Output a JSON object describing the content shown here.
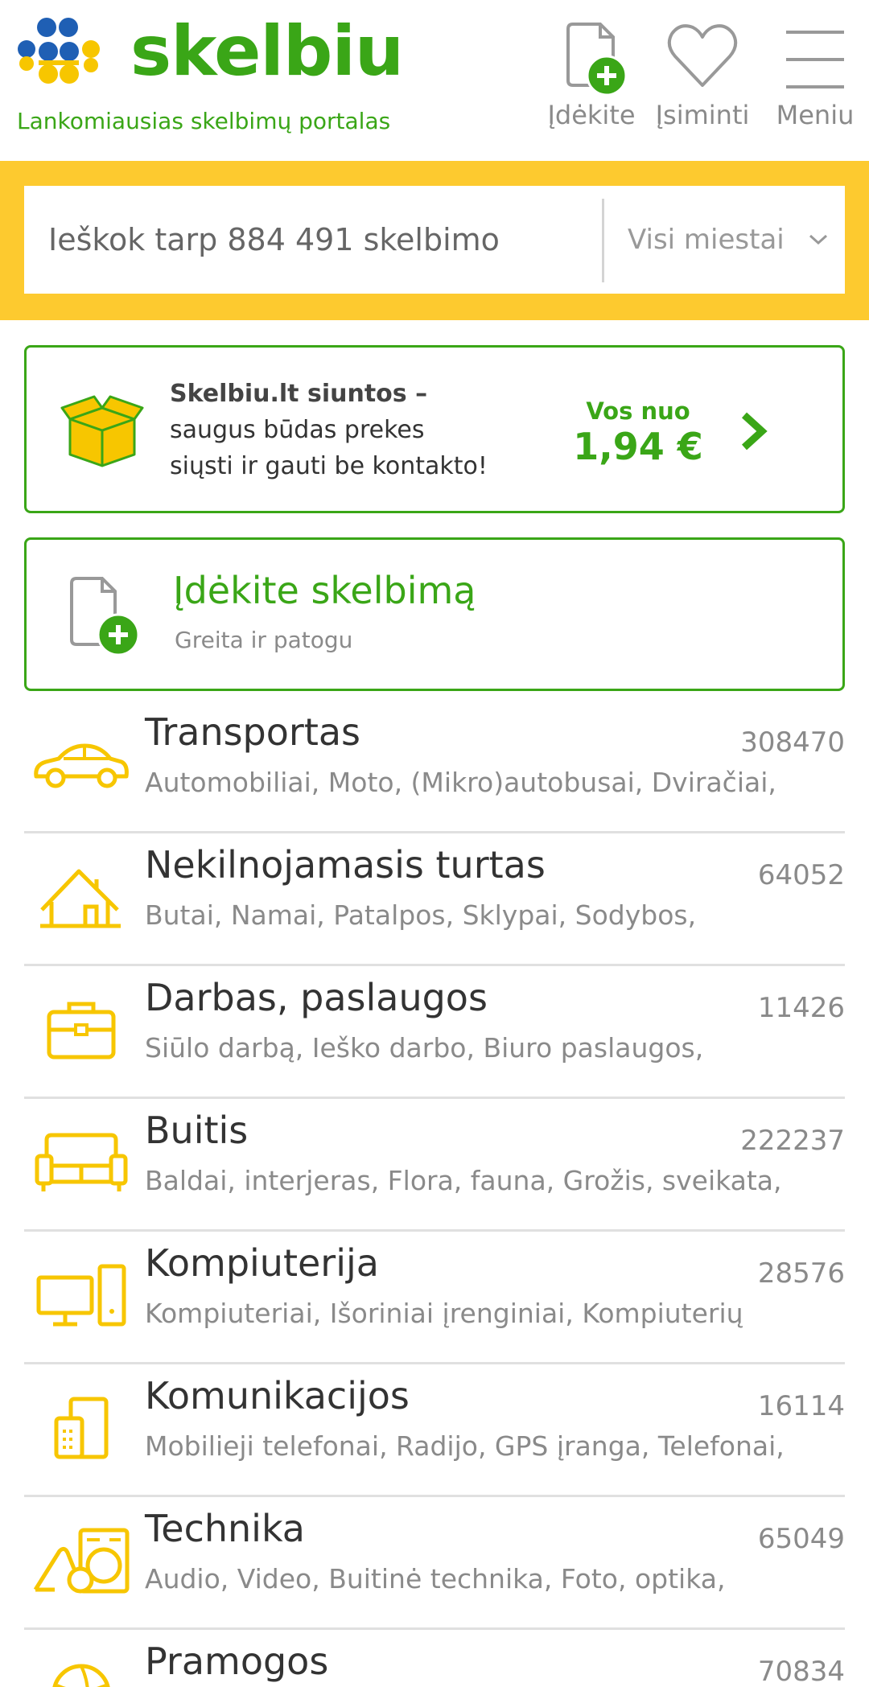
{
  "header": {
    "logo_text": "skelbiu",
    "tagline": "Lankomiausias skelbimų portalas",
    "buttons": {
      "post": "Įdėkite",
      "saved": "Įsiminti",
      "menu": "Meniu"
    }
  },
  "search": {
    "placeholder": "Ieškok tarp 884 491 skelbimo",
    "city_selected": "Visi miestai"
  },
  "promo": {
    "title": "Skelbiu.lt siuntos –",
    "line1": "saugus būdas prekes",
    "line2": "siųsti ir gauti be kontakto!",
    "from_label": "Vos nuo",
    "price": "1,94 €"
  },
  "add_ad": {
    "title": "Įdėkite skelbimą",
    "subtitle": "Greita ir patogu"
  },
  "categories": [
    {
      "name": "Transportas",
      "subs": "Automobiliai, Moto, (Mikro)autobusai, Dviračiai,",
      "count": "308470",
      "icon": "car-icon"
    },
    {
      "name": "Nekilnojamasis turtas",
      "subs": "Butai, Namai, Patalpos, Sklypai, Sodybos,",
      "count": "64052",
      "icon": "house-icon"
    },
    {
      "name": "Darbas, paslaugos",
      "subs": "Siūlo darbą, Ieško darbo, Biuro paslaugos,",
      "count": "11426",
      "icon": "briefcase-icon"
    },
    {
      "name": "Buitis",
      "subs": "Baldai, interjeras, Flora, fauna, Grožis, sveikata,",
      "count": "222237",
      "icon": "sofa-icon"
    },
    {
      "name": "Kompiuterija",
      "subs": "Kompiuteriai, Išoriniai įrenginiai, Kompiuterių",
      "count": "28576",
      "icon": "computer-icon"
    },
    {
      "name": "Komunikacijos",
      "subs": "Mobilieji telefonai, Radijo, GPS įranga, Telefonai,",
      "count": "16114",
      "icon": "phone-icon"
    },
    {
      "name": "Technika",
      "subs": "Audio, Video, Buitinė technika, Foto, optika,",
      "count": "65049",
      "icon": "appliance-icon"
    },
    {
      "name": "Pramogos",
      "subs": "",
      "count": "70834",
      "icon": "ball-icon"
    }
  ],
  "colors": {
    "brand_green": "#3aa617",
    "brand_yellow": "#fdca2f",
    "icon_yellow": "#f7c600",
    "logo_blue": "#1f5fb4"
  }
}
